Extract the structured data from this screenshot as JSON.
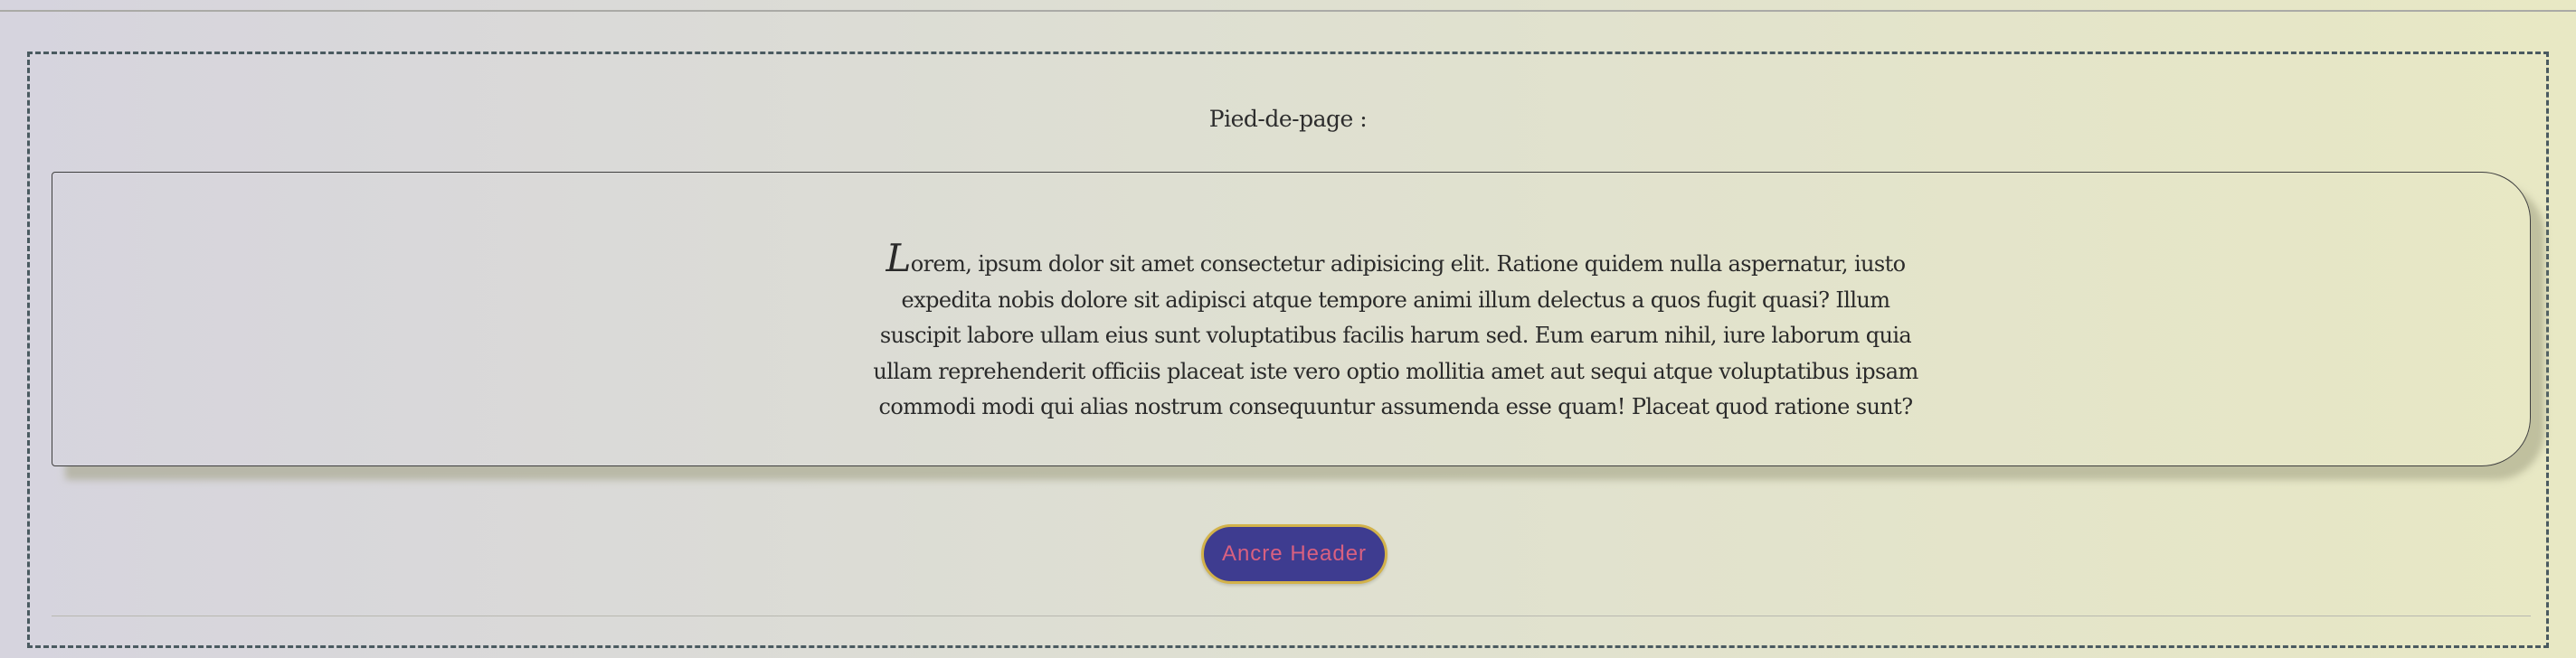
{
  "footer": {
    "label": "Pied-de-page :",
    "paragraph": {
      "dropcap": "L",
      "text": "orem, ipsum dolor sit amet consectetur adipisicing elit. Ratione quidem nulla aspernatur, iusto expedita nobis dolore sit adipisci atque tempore animi illum delectus a quos fugit quasi? Illum suscipit labore ullam eius sunt voluptatibus facilis harum sed. Eum earum nihil, iure laborum quia ullam reprehenderit officiis placeat iste vero optio mollitia amet aut sequi atque voluptatibus ipsam commodi modi qui alias nostrum consequuntur assumenda esse quam! Placeat quod ratione sunt?"
    },
    "anchor_button": "Ancre Header"
  },
  "colors": {
    "button_background": "#3e3c90",
    "button_text": "#d96080",
    "button_border": "#d2b24a",
    "section_border": "#4a5a60"
  }
}
